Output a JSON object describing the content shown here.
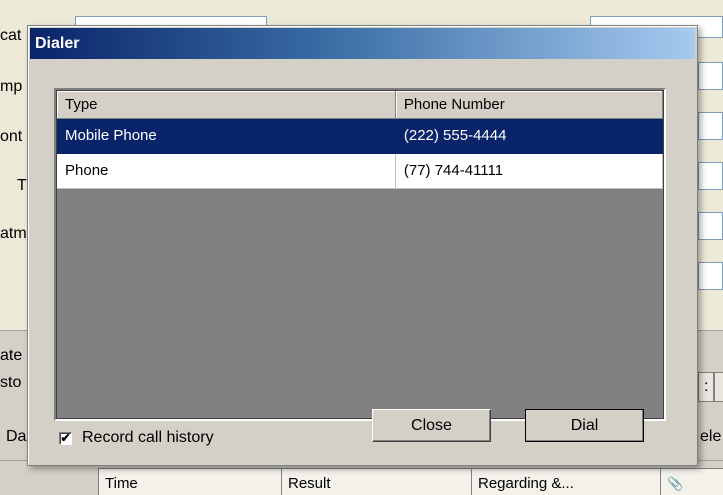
{
  "background": {
    "left_fragments": [
      "cat",
      "mp",
      "ont",
      "T",
      "atm",
      "ate",
      "sto",
      "Da"
    ],
    "right_fragments": [
      ":",
      "ele"
    ],
    "columns": [
      "Time",
      "Result",
      "Regarding &...",
      ""
    ]
  },
  "dialog": {
    "title": "Dialer",
    "grid": {
      "headers": [
        "Type",
        "Phone Number"
      ],
      "rows": [
        {
          "type": "Mobile Phone",
          "number": "(222) 555-4444",
          "selected": true
        },
        {
          "type": "Phone",
          "number": "(77) 744-41111",
          "selected": false
        }
      ]
    },
    "record_history": {
      "label": "Record call history",
      "checked": true,
      "mark": "✔"
    },
    "buttons": {
      "close": "Close",
      "dial": "Dial"
    }
  },
  "colors": {
    "selection": "#0a246a",
    "dialog_face": "#d4d0c8",
    "grid_empty": "#808080"
  }
}
